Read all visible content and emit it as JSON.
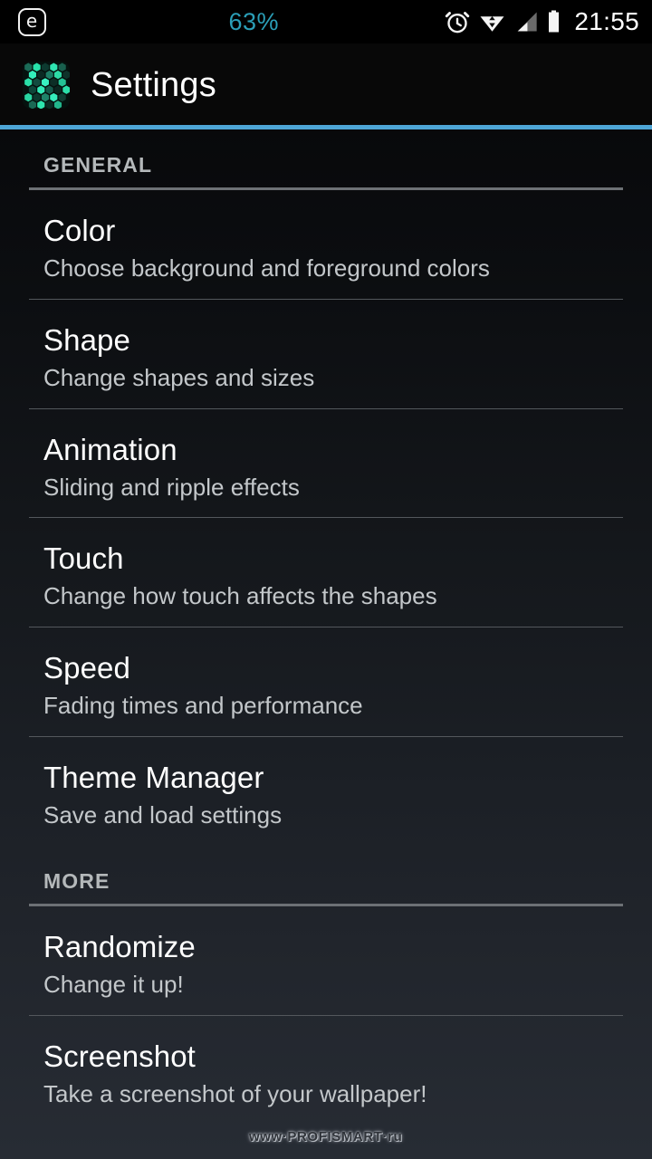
{
  "status_bar": {
    "left_icon": "e-badge-icon",
    "battery_percent": "63%",
    "battery_percent_color": "#2b9fb8",
    "icons": [
      "alarm-clock-icon",
      "wifi-icon",
      "signal-bars-icon",
      "battery-icon"
    ],
    "clock": "21:55",
    "background": "#000000"
  },
  "app_bar": {
    "icon": "hexagon-grid-app-icon",
    "title": "Settings",
    "accent_color": "#4ea6d6"
  },
  "sections": [
    {
      "header": "GENERAL",
      "items": [
        {
          "title": "Color",
          "subtitle": "Choose background and foreground colors"
        },
        {
          "title": "Shape",
          "subtitle": "Change shapes and sizes"
        },
        {
          "title": "Animation",
          "subtitle": "Sliding and ripple effects"
        },
        {
          "title": "Touch",
          "subtitle": "Change how touch affects the shapes"
        },
        {
          "title": "Speed",
          "subtitle": "Fading times and performance"
        },
        {
          "title": "Theme Manager",
          "subtitle": "Save and load settings"
        }
      ]
    },
    {
      "header": "MORE",
      "items": [
        {
          "title": "Randomize",
          "subtitle": "Change it up!"
        },
        {
          "title": "Screenshot",
          "subtitle": "Take a screenshot of your wallpaper!"
        }
      ]
    }
  ],
  "watermark": "www·PROFISMART·ru",
  "theme": {
    "bg_top": "#08090b",
    "bg_bottom": "#272c34",
    "title_color": "#ffffff",
    "subtitle_color": "#c3c7ca",
    "section_header_color": "#b4b8ba",
    "divider_color": "#53575c"
  }
}
